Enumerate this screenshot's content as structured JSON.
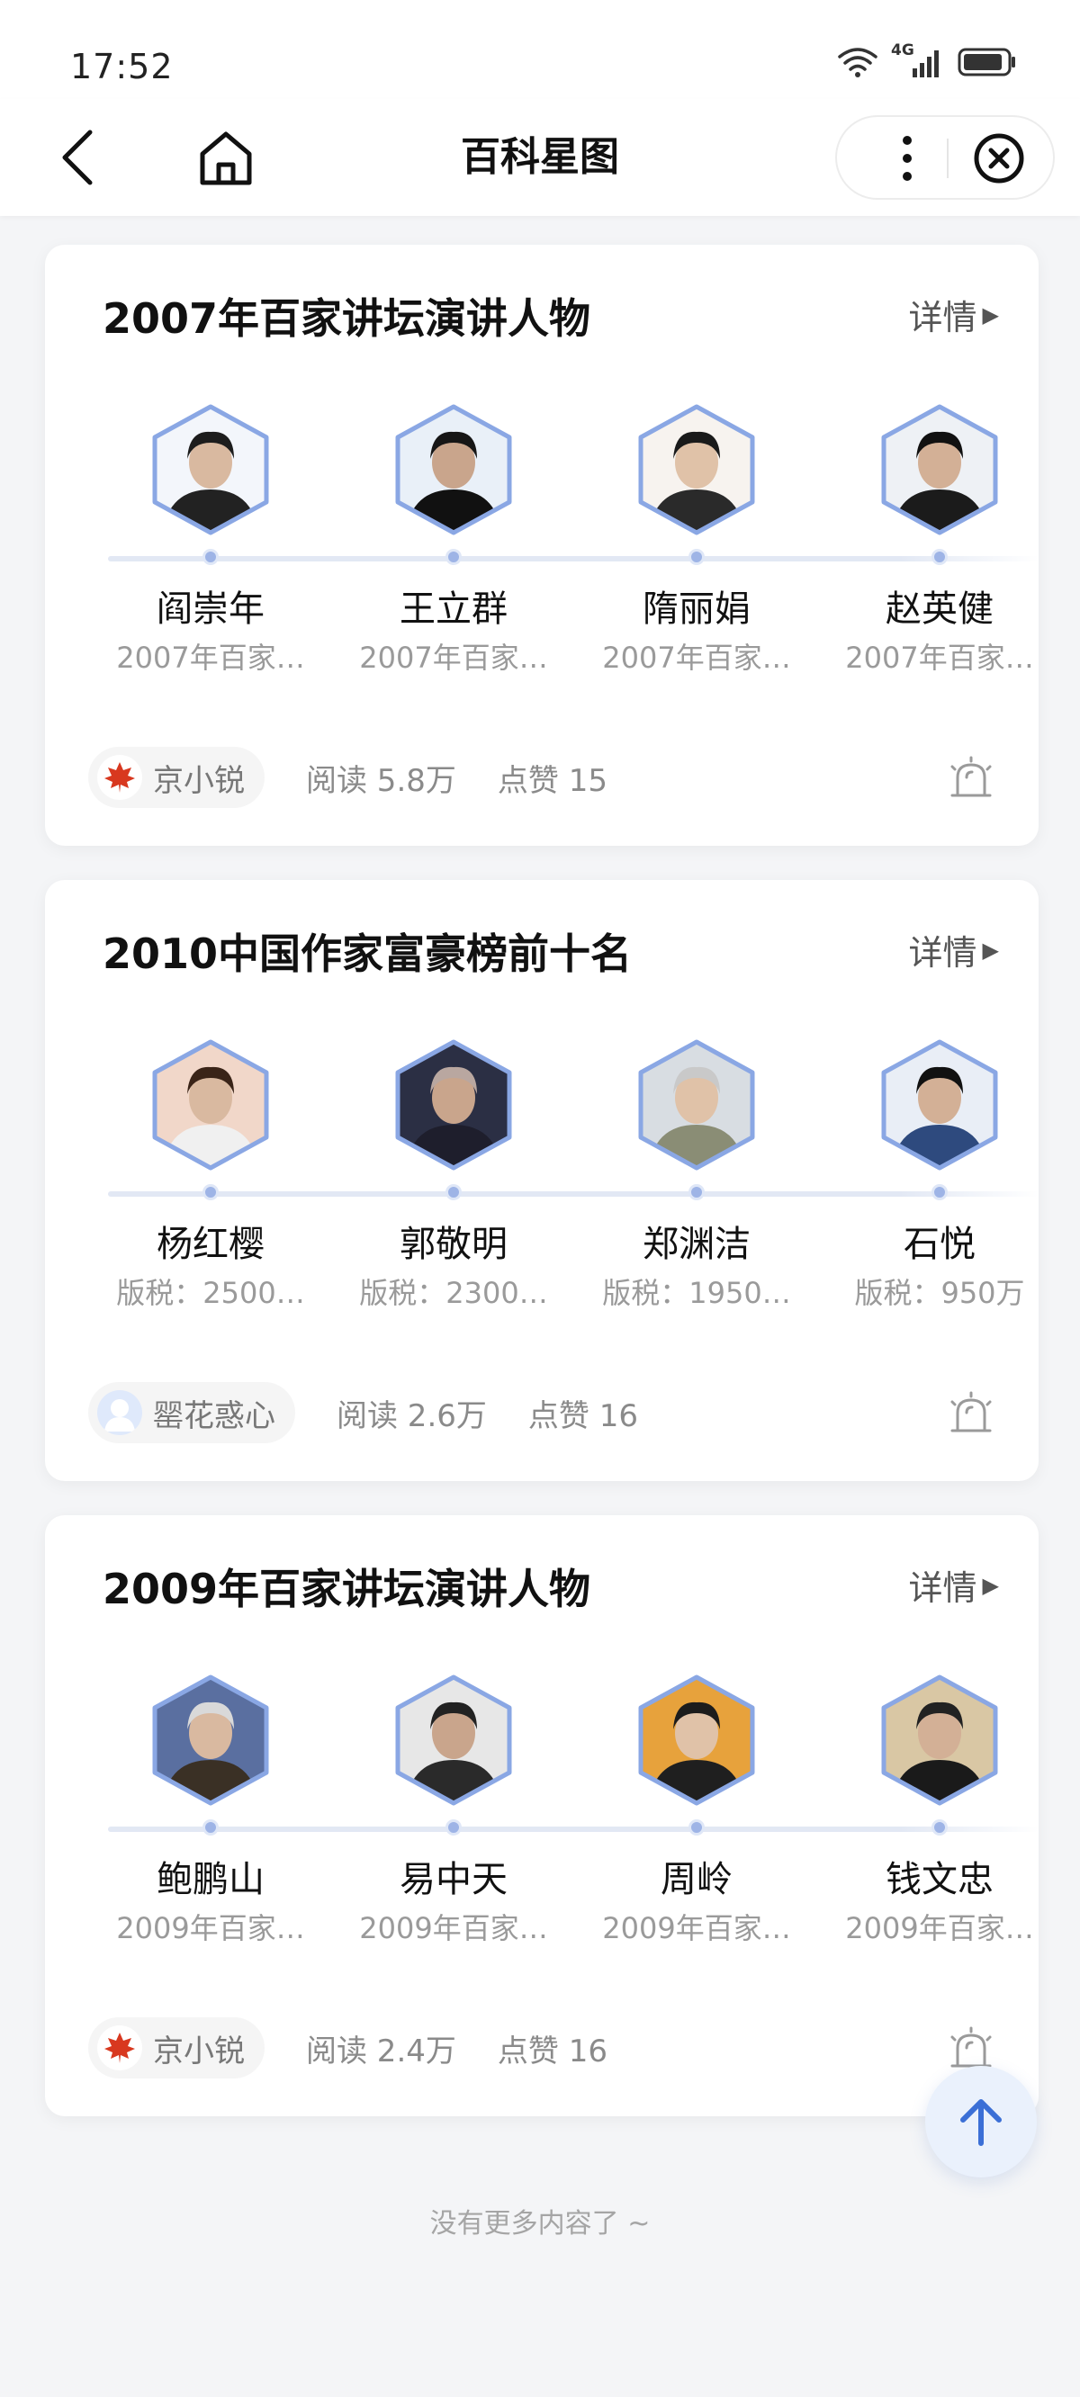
{
  "status_bar": {
    "time": "17:52",
    "network": "4G"
  },
  "nav": {
    "title": "百科星图"
  },
  "cards": [
    {
      "title": "2007年百家讲坛演讲人物",
      "detail_label": "详情",
      "people": [
        {
          "name": "阎崇年",
          "desc": "2007年百家…"
        },
        {
          "name": "王立群",
          "desc": "2007年百家…"
        },
        {
          "name": "隋丽娟",
          "desc": "2007年百家…"
        },
        {
          "name": "赵英健",
          "desc": "2007年百家…"
        }
      ],
      "author": "京小锐",
      "reads": "阅读 5.8万",
      "likes": "点赞 15"
    },
    {
      "title": "2010中国作家富豪榜前十名",
      "detail_label": "详情",
      "people": [
        {
          "name": "杨红樱",
          "desc": "版税：2500…"
        },
        {
          "name": "郭敬明",
          "desc": "版税：2300…"
        },
        {
          "name": "郑渊洁",
          "desc": "版税：1950…"
        },
        {
          "name": "石悦",
          "desc": "版税：950万"
        }
      ],
      "author": "罂花惑心",
      "reads": "阅读 2.6万",
      "likes": "点赞 16"
    },
    {
      "title": "2009年百家讲坛演讲人物",
      "detail_label": "详情",
      "people": [
        {
          "name": "鲍鹏山",
          "desc": "2009年百家…"
        },
        {
          "name": "易中天",
          "desc": "2009年百家…"
        },
        {
          "name": "周岭",
          "desc": "2009年百家…"
        },
        {
          "name": "钱文忠",
          "desc": "2009年百家…"
        }
      ],
      "author": "京小锐",
      "reads": "阅读 2.4万",
      "likes": "点赞 16"
    }
  ],
  "end_text": "没有更多内容了 ~",
  "colors": {
    "accent": "#8aa7e4",
    "timeline": "#e2e8f4",
    "muted": "#9a9a9a"
  }
}
